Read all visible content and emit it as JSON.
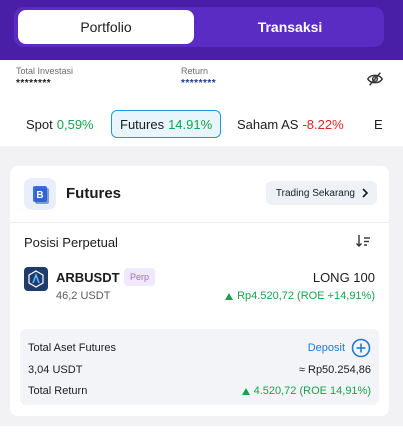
{
  "tabs": {
    "portfolio": "Portfolio",
    "transaksi": "Transaksi"
  },
  "stats": {
    "total_investasi_label": "Total Investasi",
    "total_investasi_value": "********",
    "return_label": "Return",
    "return_value": "********"
  },
  "chips": [
    {
      "name": "Spot",
      "change": "0,59%",
      "color": "green"
    },
    {
      "name": "Futures",
      "change": "14.91%",
      "color": "green",
      "selected": true
    },
    {
      "name": "Saham AS",
      "change": "-8.22%",
      "color": "red"
    },
    {
      "name": "E",
      "change": ""
    }
  ],
  "futures": {
    "title": "Futures",
    "trade_button": "Trading Sekarang",
    "positions_title": "Posisi Perpetual",
    "position": {
      "symbol": "ARBUSDT",
      "badge": "Perp",
      "qty": "46,2 USDT",
      "side": "LONG 100",
      "pnl": "Rp4.520,72 (ROE +14,91%)"
    },
    "summary": {
      "title": "Total Aset Futures",
      "deposit_label": "Deposit",
      "value": "3,04 USDT",
      "approx": "≈ Rp50.254,86",
      "return_label": "Total Return",
      "return_value": "4.520,72 (ROE 14,91%)"
    }
  },
  "colors": {
    "purple": "#4a1fa8",
    "green": "#16a34a",
    "red": "#dc2626",
    "blue": "#1e7ad7"
  },
  "icons": [
    "eye-off-icon",
    "futures-logo-icon",
    "chevron-right-icon",
    "sort-icon",
    "arb-coin-icon",
    "plus-circle-icon",
    "triangle-up-icon"
  ]
}
